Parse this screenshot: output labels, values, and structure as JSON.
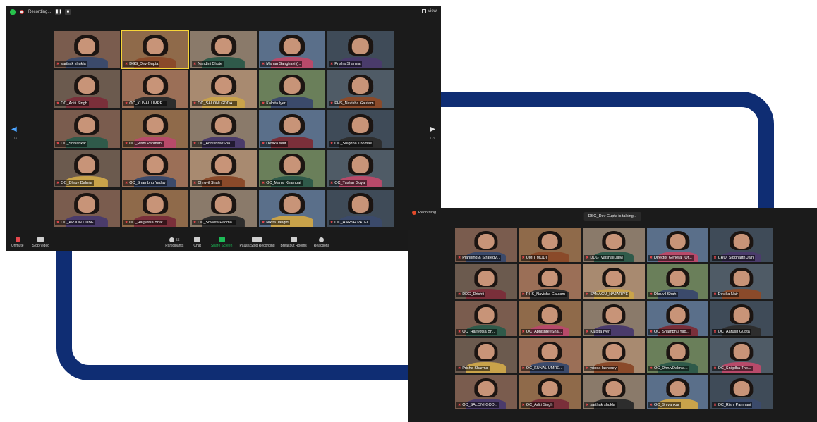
{
  "window1": {
    "recording_label": "Recording...",
    "view_label": "View",
    "page_left": "1/3",
    "page_right": "1/3",
    "toolbar": {
      "unmute": "Unmute",
      "stop_video": "Stop Video",
      "participants": "Participants",
      "participants_count": "55",
      "chat": "Chat",
      "share_screen": "Share Screen",
      "recording": "Pause/Stop Recording",
      "breakout": "Breakout Rooms",
      "reactions": "Reactions"
    },
    "tiles": [
      "sarthak shukla",
      "DGS_Dev Gupta",
      "Nandini Dhote",
      "Manan Sanghavi (...",
      "Prisha Sharma",
      "OC_Aditi Singh",
      "OC_KUNAL UMRE...",
      "OC_SALONI GODA...",
      "Kalpita Iyer",
      "PHS_Navisha Gautam",
      "OC_Shivankar",
      "OC_Rishi Panmani",
      "OC_AbhishreeSha...",
      "Devika Nair",
      "OC_Snigdha Thomas",
      "OC_Dhruv Dalmia",
      "OC_Shambhu Yadav",
      "Dhruvil Shah",
      "OC_Mansi Khambat",
      "OC_Tushar Goyal",
      "OC_ARJUN DUBE",
      "OC_Harjyotsa Bhat...",
      "OC_Shweta Padma...",
      "Nikita Jangid",
      "OC_HARSH PATEL"
    ]
  },
  "window2": {
    "recording_label": "Recording",
    "talking_banner": "DSG_Dev Gupta is talking...",
    "tiles": [
      "Planning & Strategy...",
      "UMIT MODI",
      "DDG_VaishaliDalvi",
      "Director General_Or...",
      "CRO_Siddharth Jain",
      "DDG_Drishti",
      "PHS_Navisha Gautam",
      "SAMAGU_NAJARIYE",
      "Dhruvil Shah",
      "Devika Nair",
      "OC_Harjyotsa Bh...",
      "OC_AbhishreeSha...",
      "Kalpita Iyer",
      "OC_Shambhu Yad...",
      "OC_Aarush Gupta",
      "Prisha Sharma",
      "OC_KUNAL UMRE...",
      "yrinda lachoury",
      "OC_DhruvDalmia...",
      "OC_Snigdha Tho...",
      "OC_SALONI GOD...",
      "OC_Aditi Singh",
      "sarthak shukla",
      "OC_Shivankar",
      "OC_Rishi Panmani"
    ]
  },
  "colors": {
    "frame": "#0f2d73",
    "window_bg": "#1b1b1b",
    "mic_off": "#e5484d",
    "share_green": "#1dbb57"
  }
}
